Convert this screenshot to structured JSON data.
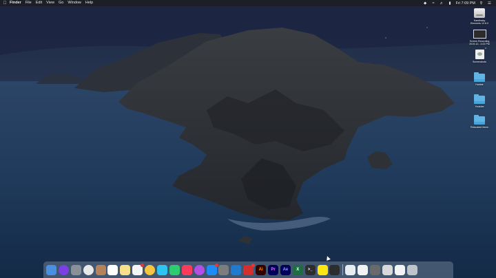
{
  "menubar": {
    "apple_icon": "apple-icon",
    "items": [
      "Finder",
      "File",
      "Edit",
      "View",
      "Go",
      "Window",
      "Help"
    ],
    "clock": "Fri 7:09 PM",
    "status_icons": [
      "dropbox-icon",
      "wifi-icon",
      "volume-icon",
      "battery-icon",
      "search-icon",
      "control-center-icon",
      "list-icon"
    ]
  },
  "desktop_icons": [
    {
      "label": "Kandinsky\nElements 12.6.0",
      "icon": "drive-icon"
    },
    {
      "label": "Screen Recording\n2019-12...3.02 PM",
      "icon": "video-file-icon"
    },
    {
      "label": "Screenshots",
      "icon": "image-file-icon"
    },
    {
      "label": "Hobbie",
      "icon": "folder-icon"
    },
    {
      "label": "Youtube",
      "icon": "folder-icon"
    },
    {
      "label": "Relocated Items",
      "icon": "folder-icon"
    }
  ],
  "dock": {
    "apps": [
      {
        "name": "finder-icon",
        "color": "#4a90e2",
        "glyph": ""
      },
      {
        "name": "siri-icon",
        "color": "#7b3fe4",
        "glyph": ""
      },
      {
        "name": "launchpad-icon",
        "color": "#8a8f98",
        "glyph": ""
      },
      {
        "name": "chrome-icon",
        "color": "#e9e9e9",
        "glyph": ""
      },
      {
        "name": "contacts-icon",
        "color": "#b5835a",
        "glyph": ""
      },
      {
        "name": "calendar-icon",
        "color": "#ffffff",
        "glyph": ""
      },
      {
        "name": "notes-icon",
        "color": "#f7e08a",
        "glyph": ""
      },
      {
        "name": "reminders-icon",
        "color": "#f5f5f5",
        "glyph": ""
      },
      {
        "name": "photos-icon",
        "color": "#f5c542",
        "glyph": ""
      },
      {
        "name": "messages-icon",
        "color": "#2ec4f1",
        "glyph": ""
      },
      {
        "name": "facetime-icon",
        "color": "#2ecc71",
        "glyph": ""
      },
      {
        "name": "music-icon",
        "color": "#fa3b5c",
        "glyph": ""
      },
      {
        "name": "podcasts-icon",
        "color": "#b150e2",
        "glyph": ""
      },
      {
        "name": "app-store-icon",
        "color": "#1e8cf7",
        "glyph": ""
      },
      {
        "name": "system-preferences-icon",
        "color": "#7d7d7d",
        "glyph": ""
      },
      {
        "name": "vscode-icon",
        "color": "#1f7ad0",
        "glyph": ""
      },
      {
        "name": "antivirus-icon",
        "color": "#d32f2f",
        "glyph": ""
      },
      {
        "name": "illustrator-icon",
        "color": "#330000",
        "glyph": "Ai",
        "text_color": "#ff9a00"
      },
      {
        "name": "premiere-icon",
        "color": "#00005b",
        "glyph": "Pr",
        "text_color": "#ea77ff"
      },
      {
        "name": "after-effects-icon",
        "color": "#00005b",
        "glyph": "Ae",
        "text_color": "#9999ff"
      },
      {
        "name": "excel-icon",
        "color": "#1d6f42",
        "glyph": "X"
      },
      {
        "name": "terminal-icon",
        "color": "#2d2d2d",
        "glyph": ">_"
      },
      {
        "name": "kakaotalk-icon",
        "color": "#ffe812",
        "glyph": ""
      },
      {
        "name": "activity-monitor-icon",
        "color": "#2d2d2d",
        "glyph": ""
      }
    ],
    "right_items": [
      {
        "name": "downloads-stack-icon",
        "color": "#e8edf2"
      },
      {
        "name": "documents-stack-icon",
        "color": "#f2f2f2"
      },
      {
        "name": "screenshot-stack-icon",
        "color": "#6a6a6a"
      },
      {
        "name": "keyboard-stack-icon",
        "color": "#d8d8d8"
      },
      {
        "name": "document-stack-icon",
        "color": "#f4f4f4"
      },
      {
        "name": "trash-icon",
        "color": "#bfc4c8"
      }
    ]
  }
}
